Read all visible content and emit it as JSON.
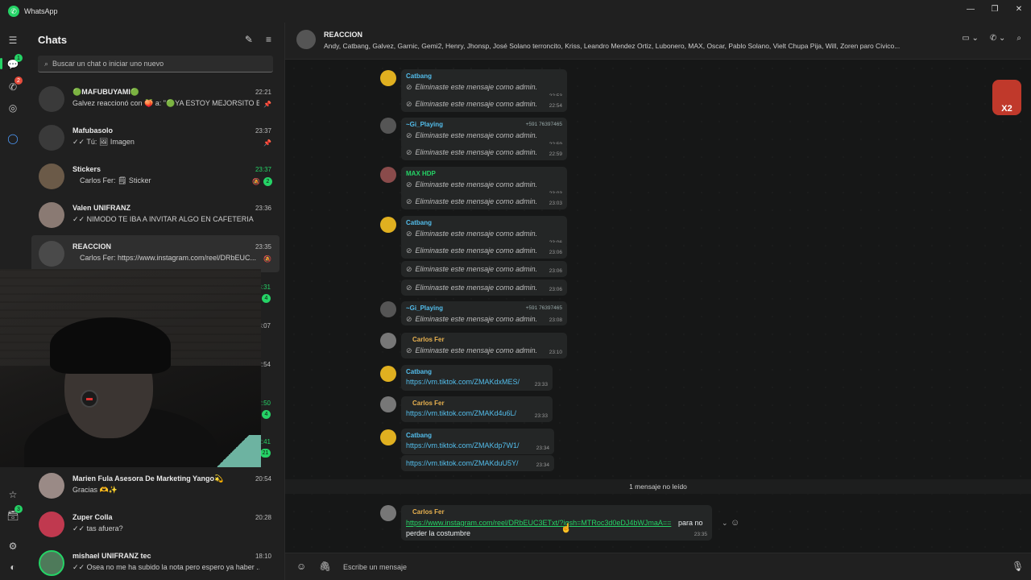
{
  "app": {
    "title": "WhatsApp"
  },
  "rail": {
    "chats_badge": "1",
    "calls_badge": "2",
    "archive_badge": "3"
  },
  "chatlist": {
    "title": "Chats",
    "search_placeholder": "Buscar un chat o iniciar uno nuevo",
    "items": [
      {
        "name": "🟢MAFUBUYAMI🟢",
        "time": "22:21",
        "preview": "Galvez reaccionó con 🍑 a: \"🟢YA ESTOY MEJORSITO B...",
        "icon": "pin-icon"
      },
      {
        "name": "Mafubasolo",
        "time": "23:37",
        "preview": "✓✓ Tú: 🖼 Imagen",
        "icon": "pin-icon"
      },
      {
        "name": "Stickers",
        "time": "23:37",
        "preview": "Carlos Fer: 🗒 Sticker",
        "unread": "2"
      },
      {
        "name": "Valen UNIFRANZ",
        "time": "23:36",
        "preview": "✓✓ NIMODO TE IBA A INVITAR ALGO EN CAFETERIA"
      },
      {
        "name": "REACCION",
        "time": "23:35",
        "preview": "Carlos Fer: https://www.instagram.com/reel/DRbEUC..."
      },
      {
        "name": "Marien Fula Asesora De Marketing Yango💫",
        "time": "20:54",
        "preview": "Gracias 🫶✨"
      },
      {
        "name": "Zuper Colla",
        "time": "20:28",
        "preview": "✓✓ tas afuera?"
      },
      {
        "name": "mishael UNIFRANZ tec",
        "time": "18:10",
        "preview": "✓✓ Osea no me ha subido la nota pero espero ya haber ..."
      }
    ],
    "hidden_times": [
      "23:31",
      "23:07",
      "22:54",
      "22:50",
      "22:41"
    ],
    "hidden_unread": [
      "4",
      "4",
      "21"
    ]
  },
  "conversation": {
    "title": "REACCION",
    "members": "Andy, Catbang, Galvez, Garnic, Gemi2, Henry, Jhonsp, José Solano terroncito, Kriss, Leandro Mendez Ortiz, Lubonero, MAX, Oscar, Pablo Solano, Vielt Chupa Pija, Will, Zoren paro Civico...",
    "deleted_text": "Eliminaste este mensaje como admin.",
    "sticker_label": "X2",
    "groups": [
      {
        "sender": "Catbang",
        "color": "#53bdeb",
        "times": [
          "22:53",
          "22:54"
        ]
      },
      {
        "sender": "~Gi_Playing",
        "phone": "+591 76397465",
        "color": "#53bdeb",
        "times": [
          "22:59",
          "22:59"
        ]
      },
      {
        "sender": "MAX HDP",
        "color": "#25d366",
        "times": [
          "23:03",
          "23:03"
        ]
      },
      {
        "sender": "Catbang",
        "color": "#53bdeb",
        "times": [
          "23:06",
          "23:06",
          "23:06",
          "23:06"
        ]
      },
      {
        "sender": "~Gi_Playing",
        "phone": "+591 76397465",
        "color": "#53bdeb",
        "times": [
          "23:08"
        ]
      },
      {
        "sender": "Carlos Fer",
        "color": "#e8b14f",
        "times": [
          "23:10"
        ]
      }
    ],
    "links": [
      {
        "sender": "Catbang",
        "url": "https://vm.tiktok.com/ZMAKdxMES/",
        "time": "23:33"
      },
      {
        "sender": "Carlos Fer",
        "url": "https://vm.tiktok.com/ZMAKd4u6L/",
        "time": "23:33"
      },
      {
        "sender": "Catbang",
        "url": "https://vm.tiktok.com/ZMAKdp7W1/",
        "time": "23:34"
      },
      {
        "sender": "",
        "url": "https://vm.tiktok.com/ZMAKduU5Y/",
        "time": "23:34"
      }
    ],
    "unread_divider": "1 mensaje no leído",
    "last_message": {
      "sender": "Carlos Fer",
      "url": "https://www.instagram.com/reel/DRbEUC3ETxt/?igsh=MTRoc3d0eDJ4bWJmaA==",
      "text_after": "para no",
      "text_line2": "perder la costumbre",
      "time": "23:35"
    },
    "composer_placeholder": "Escribe un mensaje"
  }
}
